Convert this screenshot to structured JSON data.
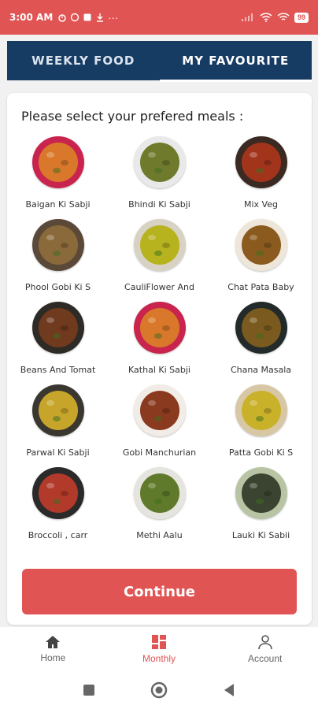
{
  "status_bar": {
    "time": "3:00 AM",
    "dots": "···",
    "battery": "99"
  },
  "tabs": [
    {
      "label": "WEEKLY FOOD",
      "active": false
    },
    {
      "label": "MY FAVOURITE",
      "active": true
    }
  ],
  "prompt": "Please select your prefered meals :",
  "meals": [
    {
      "name": "Baigan Ki Sabji",
      "plate": "#c9244e",
      "food": "#d9782a"
    },
    {
      "name": "Bhindi Ki Sabji",
      "plate": "#e9e9e9",
      "food": "#6f7a2c"
    },
    {
      "name": "Mix Veg",
      "plate": "#3a2a22",
      "food": "#a3341c"
    },
    {
      "name": "Phool Gobi Ki S",
      "plate": "#5a4838",
      "food": "#8a6a3a"
    },
    {
      "name": "CauliFlower And",
      "plate": "#d8d2c4",
      "food": "#b7b31f"
    },
    {
      "name": "Chat Pata Baby",
      "plate": "#efe6da",
      "food": "#8a5a1e"
    },
    {
      "name": "Beans And Tomat",
      "plate": "#2e2a26",
      "food": "#6f3a1e"
    },
    {
      "name": "Kathal Ki Sabji",
      "plate": "#c9244e",
      "food": "#d9782a"
    },
    {
      "name": "Chana Masala",
      "plate": "#222a2a",
      "food": "#7a5a1e"
    },
    {
      "name": "Parwal Ki Sabji",
      "plate": "#3a3630",
      "food": "#c7a52a"
    },
    {
      "name": "Gobi Manchurian",
      "plate": "#f1ede6",
      "food": "#8a3a1e"
    },
    {
      "name": "Patta Gobi Ki S",
      "plate": "#d7c7a4",
      "food": "#c9b22a"
    },
    {
      "name": "Broccoli , carr",
      "plate": "#2a2a2a",
      "food": "#b23a2a"
    },
    {
      "name": "Methi Aalu",
      "plate": "#e6e4de",
      "food": "#5f7a2a"
    },
    {
      "name": "Lauki Ki Sabii",
      "plate": "#b8c4a4",
      "food": "#3a4430"
    }
  ],
  "continue_label": "Continue",
  "bottom_nav": [
    {
      "label": "Home",
      "icon": "home-icon",
      "active": false
    },
    {
      "label": "Monthly",
      "icon": "grid-icon",
      "active": true
    },
    {
      "label": "Account",
      "icon": "person-icon",
      "active": false
    }
  ],
  "colors": {
    "accent": "#e15454",
    "tab_bar": "#173c63"
  }
}
